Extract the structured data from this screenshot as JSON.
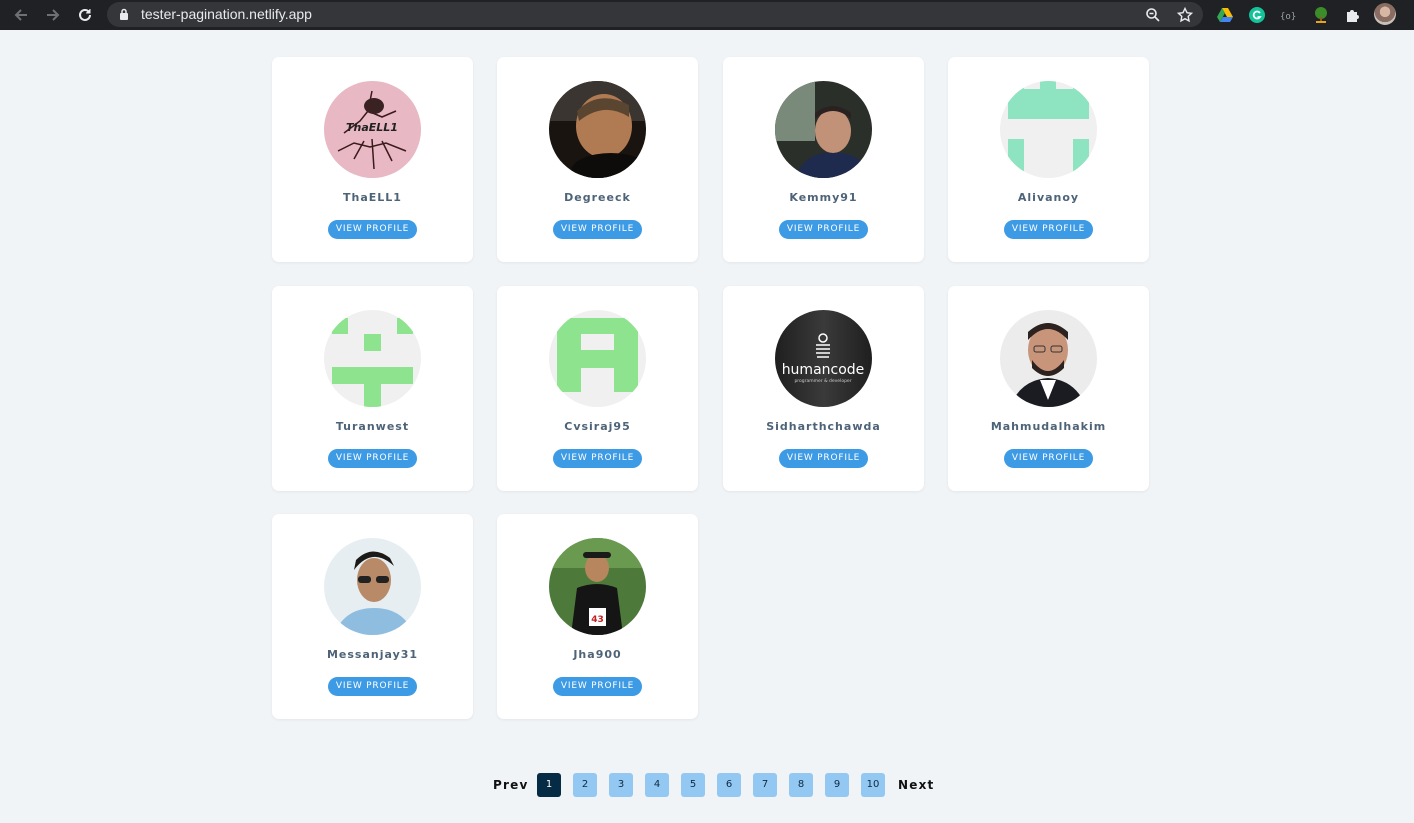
{
  "browser": {
    "url": "tester-pagination.netlify.app"
  },
  "users": [
    {
      "name": "ThaELL1",
      "avatar_text": "ThaELL1"
    },
    {
      "name": "Degreeck"
    },
    {
      "name": "Kemmy91"
    },
    {
      "name": "Alivanoy"
    },
    {
      "name": "Turanwest"
    },
    {
      "name": "Cvsiraj95"
    },
    {
      "name": "Sidharthchawda",
      "avatar_text": "humancode",
      "avatar_subtext": "programmer & developer"
    },
    {
      "name": "Mahmudalhakim"
    },
    {
      "name": "Messanjay31"
    },
    {
      "name": "Jha900",
      "avatar_text": "43"
    }
  ],
  "buttons": {
    "view_profile": "VIEW PROFILE"
  },
  "pagination": {
    "prev": "Prev",
    "next": "Next",
    "pages": [
      "1",
      "2",
      "3",
      "4",
      "5",
      "6",
      "7",
      "8",
      "9",
      "10"
    ],
    "current": "1"
  },
  "colors": {
    "page_background": "#f1f4f7",
    "button": "#3d9ae4",
    "page_active": "#062b45",
    "page_inactive": "#93c8f3"
  }
}
